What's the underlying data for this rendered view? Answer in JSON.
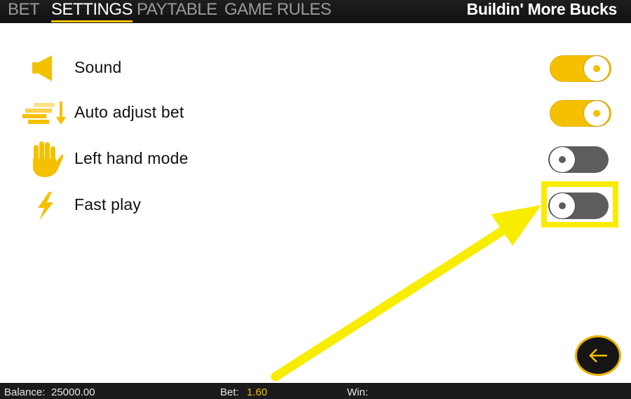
{
  "tabs": [
    {
      "label": "BET",
      "active": false
    },
    {
      "label": "SETTINGS",
      "active": true
    },
    {
      "label": "PAYTABLE",
      "active": false
    },
    {
      "label": "GAME RULES",
      "active": false
    }
  ],
  "game_title": "Buildin'  More Bucks",
  "settings": [
    {
      "label": "Sound",
      "icon": "speaker-icon",
      "enabled": true
    },
    {
      "label": "Auto adjust bet",
      "icon": "auto-adjust-bet-icon",
      "enabled": true
    },
    {
      "label": "Left hand mode",
      "icon": "hand-icon",
      "enabled": false
    },
    {
      "label": "Fast play",
      "icon": "lightning-icon",
      "enabled": false
    }
  ],
  "back_button": {
    "icon": "arrow-left-icon"
  },
  "status": {
    "balance_label": "Balance:",
    "balance_value": "25000.00",
    "bet_label": "Bet:",
    "bet_value": "1.60",
    "win_label": "Win:"
  },
  "colors": {
    "accent": "#f5c000",
    "toggle_off": "#5d5d5d",
    "annotation": "#f8ec00",
    "bar_bg": "#151515"
  }
}
